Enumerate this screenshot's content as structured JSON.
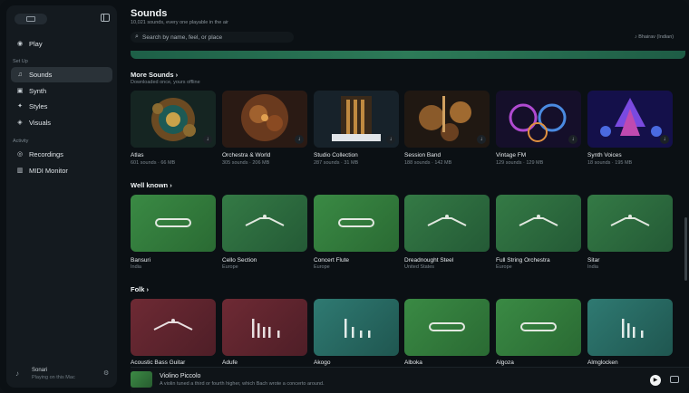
{
  "sidebar": {
    "items": [
      {
        "label": "Play",
        "icon": "play-icon"
      },
      {
        "label": "Sounds",
        "icon": "sounds-icon",
        "active": true
      },
      {
        "label": "Synth",
        "icon": "synth-icon"
      },
      {
        "label": "Styles",
        "icon": "styles-icon"
      },
      {
        "label": "Visuals",
        "icon": "visuals-icon"
      },
      {
        "label": "Recordings",
        "icon": "recordings-icon"
      },
      {
        "label": "MIDI Monitor",
        "icon": "midi-icon"
      }
    ],
    "section_setup": "Set Up",
    "section_activity": "Activity",
    "footer": {
      "app": "Sonari",
      "status": "Playing on this Mac"
    }
  },
  "header": {
    "title": "Sounds",
    "subtitle": "10,021 sounds, every one playable in the air",
    "search_placeholder": "Search by name, feel, or place",
    "scale": "Bhairav (Indian)"
  },
  "more_sounds": {
    "title": "More Sounds",
    "chevron": "›",
    "subtitle": "Downloaded once, yours offline",
    "items": [
      {
        "name": "Atlas",
        "meta": "601 sounds · 66 MB"
      },
      {
        "name": "Orchestra & World",
        "meta": "305 sounds · 206 MB"
      },
      {
        "name": "Studio Collection",
        "meta": "287 sounds · 31 MB"
      },
      {
        "name": "Session Band",
        "meta": "188 sounds · 142 MB"
      },
      {
        "name": "Vintage FM",
        "meta": "129 sounds · 129 MB"
      },
      {
        "name": "Synth Voices",
        "meta": "18 sounds · 195 MB"
      }
    ]
  },
  "well_known": {
    "title": "Well known",
    "chevron": "›",
    "items": [
      {
        "name": "Bansuri",
        "meta": "India"
      },
      {
        "name": "Cello Section",
        "meta": "Europe"
      },
      {
        "name": "Concert Flute",
        "meta": "Europe"
      },
      {
        "name": "Dreadnought Steel",
        "meta": "United States"
      },
      {
        "name": "Full String Orchestra",
        "meta": "Europe"
      },
      {
        "name": "Sitar",
        "meta": "India"
      }
    ]
  },
  "folk": {
    "title": "Folk",
    "chevron": "›",
    "items": [
      {
        "name": "Acoustic Bass Guitar"
      },
      {
        "name": "Adufe"
      },
      {
        "name": "Akogo"
      },
      {
        "name": "Alboka"
      },
      {
        "name": "Algoza"
      },
      {
        "name": "Almglocken"
      }
    ]
  },
  "player": {
    "name": "Violino Piccolo",
    "description": "A violin tuned a third or fourth higher, which Bach wrote a concerto around."
  },
  "colors": {
    "accent_green": "#3a8a44",
    "folk_red": "#6e2a34",
    "folk_teal": "#2f7a72",
    "active_bg": "#2a3238"
  }
}
